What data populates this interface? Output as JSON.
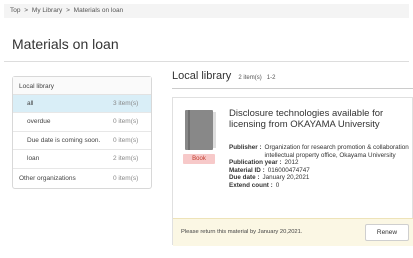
{
  "breadcrumb": {
    "items": [
      "Top",
      "My Library",
      "Materials on loan"
    ],
    "separator": ">"
  },
  "page": {
    "title": "Materials on loan"
  },
  "sidebar": {
    "group_label": "Local library",
    "items": [
      {
        "label": "all",
        "count": "3 item(s)",
        "active": true
      },
      {
        "label": "overdue",
        "count": "0 item(s)",
        "active": false
      },
      {
        "label": "Due date is coming soon.",
        "count": "0 item(s)",
        "active": false
      },
      {
        "label": "loan",
        "count": "2 item(s)",
        "active": false
      }
    ],
    "other": {
      "label": "Other organizations",
      "count": "0 item(s)"
    }
  },
  "results": {
    "heading": "Local library",
    "count": "2 item(s)",
    "range": "1-2"
  },
  "card": {
    "type": "Book",
    "title": "Disclosure technologies available for licensing from OKAYAMA University",
    "publisher_label": "Publisher :",
    "publisher": "Organization for research promotion & collaboration intellectual property office, Okayama University",
    "pubyear_label": "Publication year :",
    "pubyear": "2012",
    "material_id_label": "Material ID :",
    "material_id": "016000474747",
    "due_date_label": "Due date :",
    "due_date": "January 20,2021",
    "extend_label": "Extend count :",
    "extend_count": "0",
    "notice": "Please return this material by January 20,2021.",
    "renew_label": "Renew"
  },
  "colors": {
    "active_item_bg": "#d9eef7",
    "badge_bg": "#f7c9c9",
    "badge_text": "#c0392b",
    "footer_bg": "#fbf7e4"
  }
}
